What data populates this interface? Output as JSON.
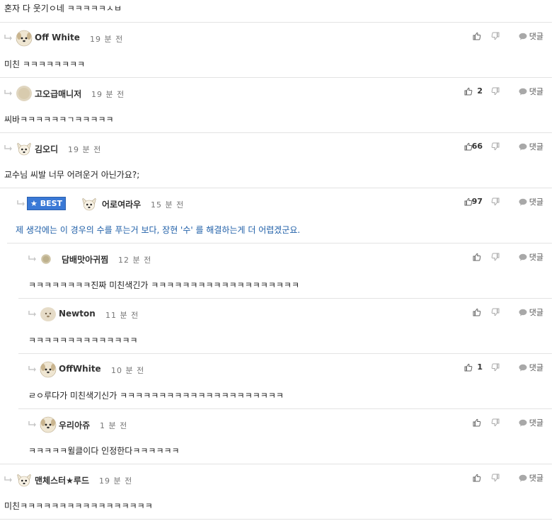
{
  "top_comment": {
    "text": "혼자 다 웃기ㅇ네 ㅋㅋㅋㅋㅋㅅㅂ"
  },
  "reply_label": "댓글",
  "best_label": "★ BEST",
  "comments": [
    {
      "name": "Off White",
      "time": "19 분 전",
      "text": "미친 ㅋㅋㅋㅋㅋㅋㅋㅋ",
      "likes": "",
      "avatar": "dog"
    },
    {
      "name": "고오급매니저",
      "time": "19 분 전",
      "text": "씨바ㅋㅋㅋㅋㅋㅋㄱㅋㅋㅋㅋㅋ",
      "likes": "2",
      "avatar": "blob"
    },
    {
      "name": "김오디",
      "time": "19 분 전",
      "text": "교수님 씨발 너무 어려운거 아닌가요?;",
      "likes": "66",
      "avatar": "chihuahua"
    },
    {
      "name": "어로여라우",
      "time": "15 분 전",
      "text": "제 생각에는 이 경우의 수를 푸는거 보다, 장현 '수' 를 해결하는게 더 어렵겠군요.",
      "likes": "97",
      "avatar": "chihuahua",
      "best": true
    },
    {
      "name": "담배맛아귀찜",
      "time": "12 분 전",
      "text": "ㅋㅋㅋㅋㅋㅋㅋㅋ진짜 미친색긴가 ㅋㅋㅋㅋㅋㅋㅋㅋㅋㅋㅋㅋㅋㅋㅋㅋㅋㅋㅋ",
      "likes": "",
      "avatar": "small"
    },
    {
      "name": "Newton",
      "time": "11 분 전",
      "text": "ㅋㅋㅋㅋㅋㅋㅋㅋㅋㅋㅋㅋㅋㅋ",
      "likes": "",
      "avatar": "blobdog"
    },
    {
      "name": "OffWhite",
      "time": "10 분 전",
      "text": "ㄹㅇ루다가 미친색기신가 ㅋㅋㅋㅋㅋㅋㅋㅋㅋㅋㅋㅋㅋㅋㅋㅋㅋㅋㅋㅋㅋ",
      "likes": "1",
      "avatar": "dog"
    },
    {
      "name": "우리아쥬",
      "time": "1 분 전",
      "text": "ㅋㅋㅋㅋㅋ윌클이다 인정한다ㅋㅋㅋㅋㅋㅋ",
      "likes": "",
      "avatar": "dog"
    },
    {
      "name": "맨체스터★루드",
      "time": "19 분 전",
      "text": "미친ㅋㅋㅋㅋㅋㅋㅋㅋㅋㅋㅋㅋㅋㅋㅋㅋㅋ",
      "likes": "",
      "avatar": "chihuahua"
    }
  ]
}
